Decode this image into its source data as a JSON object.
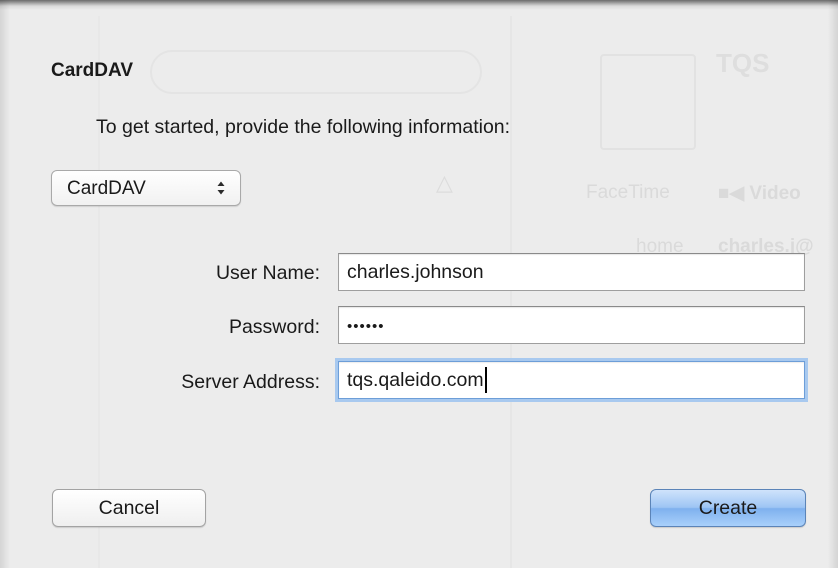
{
  "background_window": {
    "contact_name": "TQS",
    "facetime_label": "FaceTime",
    "video_label": "Video",
    "email_label": "home",
    "email_value": "charles.j@"
  },
  "sheet": {
    "title": "CardDAV",
    "intro": "To get started, provide the following information:",
    "account_type": {
      "selected": "CardDAV"
    },
    "fields": {
      "user_name": {
        "label": "User Name:",
        "value": "charles.johnson"
      },
      "password": {
        "label": "Password:",
        "masked_value": "••••••"
      },
      "server_address": {
        "label": "Server Address:",
        "value": "tqs.qaleido.com"
      }
    },
    "buttons": {
      "cancel": "Cancel",
      "create": "Create"
    }
  },
  "colors": {
    "sheet_background": "#ececec",
    "focus_ring": "#a8c9ef",
    "default_button": "#9ec5f4"
  }
}
